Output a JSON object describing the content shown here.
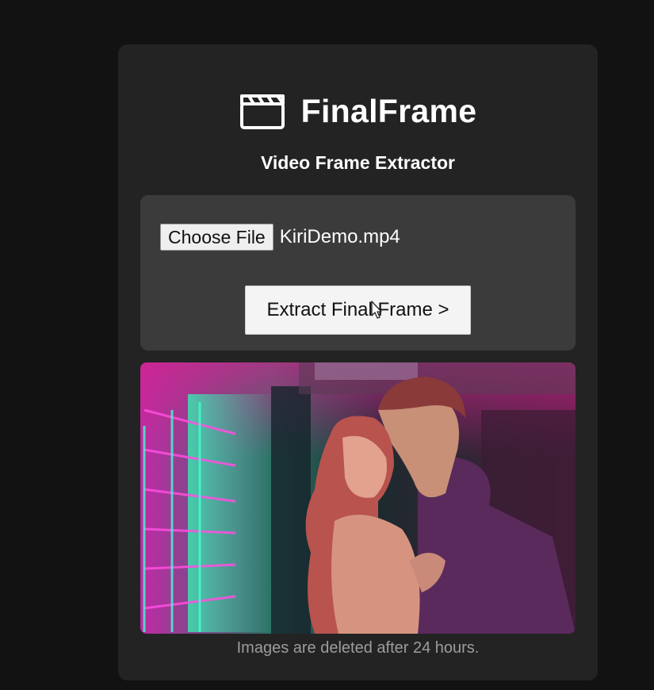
{
  "app": {
    "title": "FinalFrame",
    "icon": "clapperboard-icon",
    "subtitle": "Video Frame Extractor"
  },
  "upload": {
    "choose_file_label": "Choose File",
    "file_name": "KiriDemo.mp4",
    "extract_label": "Extract Final Frame >"
  },
  "preview": {
    "icon": "extracted-frame-image"
  },
  "footer": {
    "note": "Images are deleted after 24 hours."
  },
  "colors": {
    "page_bg": "#121212",
    "card_bg": "#232323",
    "panel_bg": "#3b3b3b",
    "button_bg": "#f4f4f4",
    "footnote": "#9c9c9c"
  }
}
